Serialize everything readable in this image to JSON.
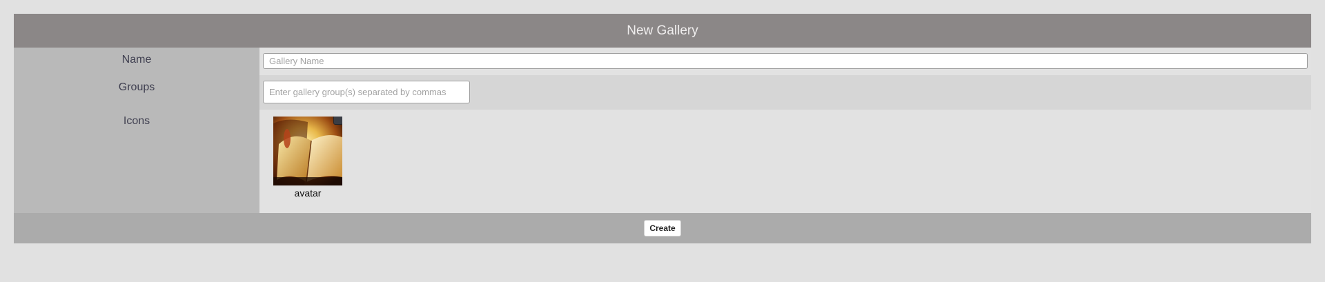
{
  "header": {
    "title": "New Gallery"
  },
  "form": {
    "name": {
      "label": "Name",
      "value": "",
      "placeholder": "Gallery Name"
    },
    "groups": {
      "label": "Groups",
      "value": "",
      "placeholder": "Enter gallery group(s) separated by commas"
    },
    "icons": {
      "label": "Icons",
      "items": [
        {
          "caption": "avatar",
          "selected": true,
          "icon": "open-book-image"
        }
      ]
    }
  },
  "footer": {
    "create_label": "Create"
  },
  "colors": {
    "background": "#e1e1e1",
    "header": "#8b8787",
    "label_column": "#b9b9b9",
    "footer": "#ababab",
    "row_alt": "#d6d6d6"
  }
}
